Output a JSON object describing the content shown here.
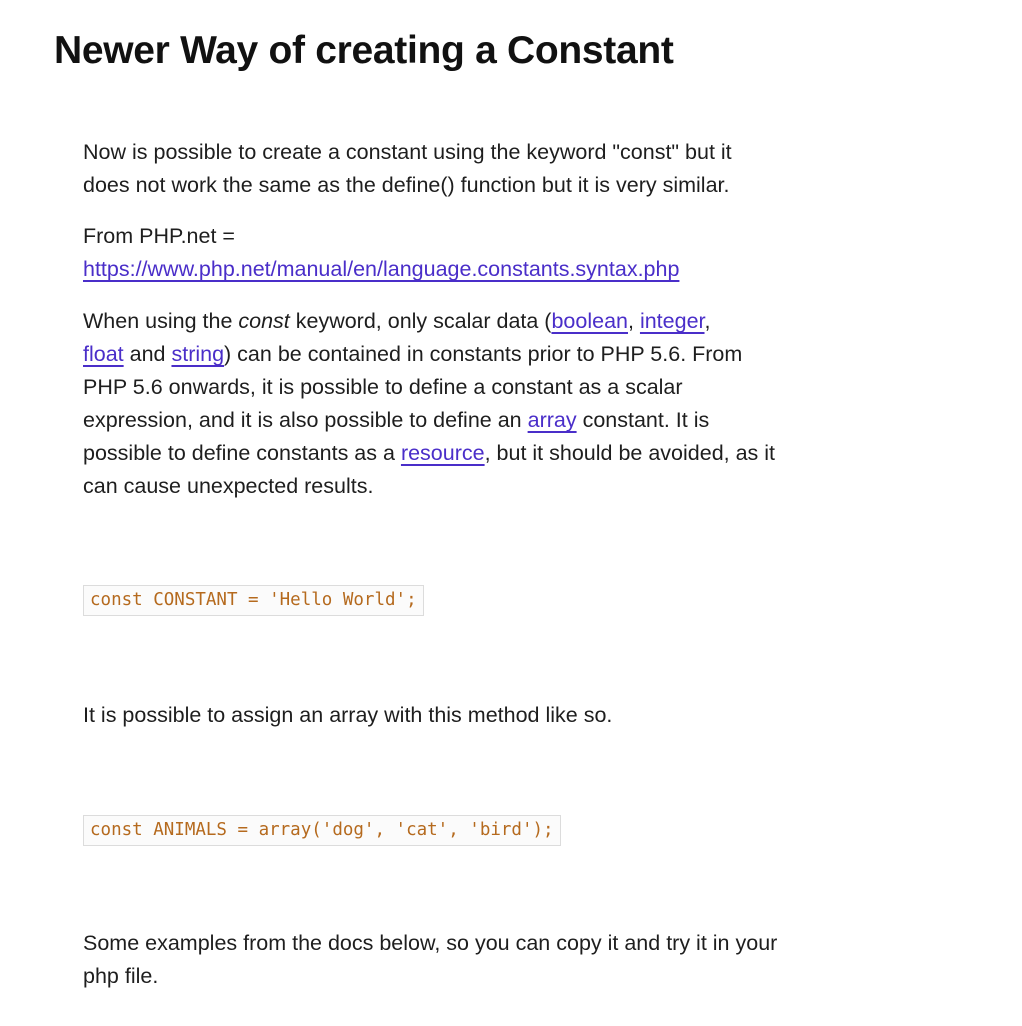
{
  "article": {
    "title": "Newer Way of creating a Constant",
    "intro": "Now is possible to create a constant using the keyword \"const\" but it does not work the same as the define() function but it is very similar.",
    "from_label": "From PHP.net =",
    "from_link": "https://www.php.net/manual/en/language.constants.syntax.php",
    "quote": {
      "t1": "When using the ",
      "kw": "const",
      "t2": " keyword, only scalar data (",
      "link_boolean": "boolean",
      "t3": ", ",
      "link_integer": "integer",
      "t4": ", ",
      "link_float": "float",
      "t5": " and ",
      "link_string": "string",
      "t6": ") can be contained in constants prior to PHP 5.6. From PHP 5.6 onwards, it is possible to define a constant as a scalar expression, and it is also possible to define an ",
      "link_array": "array",
      "t7": " constant. It is possible to define constants as a ",
      "link_resource": "resource",
      "t8": ", but it should be avoided, as it can cause unexpected results."
    },
    "code1": "const CONSTANT = 'Hello World';",
    "array_text": "It is possible to assign an array with this method like so.",
    "code2": "const ANIMALS = array('dog', 'cat', 'bird');",
    "outro": "Some examples from the docs below, so you can copy it and try it in your php file."
  },
  "colors": {
    "text": "#1e1e1e",
    "link": "#4a2ec9",
    "code_text": "#b56a1e",
    "code_border": "#dcdcdc"
  }
}
